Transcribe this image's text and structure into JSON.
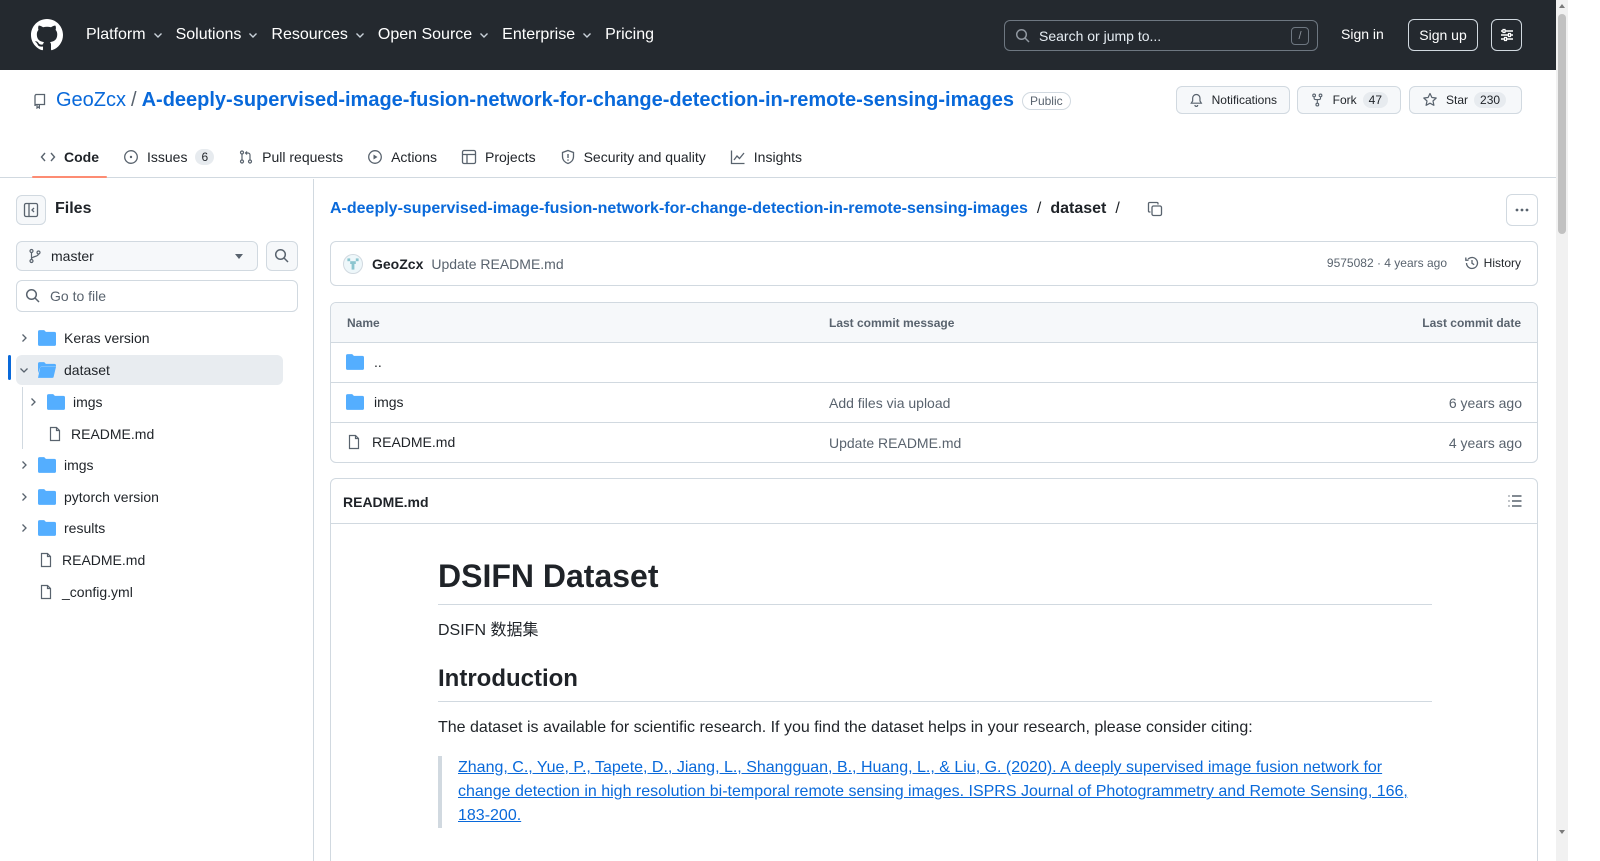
{
  "header": {
    "nav": [
      {
        "label": "Platform",
        "has_menu": true
      },
      {
        "label": "Solutions",
        "has_menu": true
      },
      {
        "label": "Resources",
        "has_menu": true
      },
      {
        "label": "Open Source",
        "has_menu": true
      },
      {
        "label": "Enterprise",
        "has_menu": true
      },
      {
        "label": "Pricing",
        "has_menu": false
      }
    ],
    "search_placeholder": "Search or jump to...",
    "search_shortcut": "/",
    "sign_in": "Sign in",
    "sign_up": "Sign up"
  },
  "repo": {
    "owner": "GeoZcx",
    "separator": "/",
    "name": "A-deeply-supervised-image-fusion-network-for-change-detection-in-remote-sensing-images",
    "visibility": "Public",
    "notifications_label": "Notifications",
    "fork_label": "Fork",
    "fork_count": "47",
    "star_label": "Star",
    "star_count": "230",
    "tabs": [
      {
        "label": "Code",
        "icon": "code-icon",
        "active": true
      },
      {
        "label": "Issues",
        "icon": "issue-icon",
        "count": "6"
      },
      {
        "label": "Pull requests",
        "icon": "pull-request-icon"
      },
      {
        "label": "Actions",
        "icon": "play-icon"
      },
      {
        "label": "Projects",
        "icon": "table-icon"
      },
      {
        "label": "Security and quality",
        "icon": "shield-icon"
      },
      {
        "label": "Insights",
        "icon": "graph-icon"
      }
    ]
  },
  "sidebar": {
    "title": "Files",
    "branch": "master",
    "goto_placeholder": "Go to file",
    "tree": [
      {
        "label": "Keras version",
        "type": "folder",
        "depth": 0,
        "expanded": false
      },
      {
        "label": "dataset",
        "type": "folder",
        "depth": 0,
        "expanded": true,
        "selected": true
      },
      {
        "label": "imgs",
        "type": "folder",
        "depth": 1,
        "expanded": false
      },
      {
        "label": "README.md",
        "type": "file",
        "depth": 1
      },
      {
        "label": "imgs",
        "type": "folder",
        "depth": 0,
        "expanded": false
      },
      {
        "label": "pytorch version",
        "type": "folder",
        "depth": 0,
        "expanded": false
      },
      {
        "label": "results",
        "type": "folder",
        "depth": 0,
        "expanded": false
      },
      {
        "label": "README.md",
        "type": "file",
        "depth": 0
      },
      {
        "label": "_config.yml",
        "type": "file",
        "depth": 0
      }
    ]
  },
  "breadcrumb": {
    "repo_link": "A-deeply-supervised-image-fusion-network-for-change-detection-in-remote-sensing-images",
    "separator": "/",
    "current": "dataset",
    "trailing": "/"
  },
  "commit": {
    "author": "GeoZcx",
    "message": "Update README.md",
    "meta": "9575082 · 4 years ago",
    "history_label": "History"
  },
  "table": {
    "headers": {
      "name": "Name",
      "message": "Last commit message",
      "date": "Last commit date"
    },
    "rows": [
      {
        "name": "..",
        "type": "folder",
        "message": "",
        "date": ""
      },
      {
        "name": "imgs",
        "type": "folder",
        "message": "Add files via upload",
        "date": "6 years ago"
      },
      {
        "name": "README.md",
        "type": "file",
        "message": "Update README.md",
        "date": "4 years ago"
      }
    ]
  },
  "readme": {
    "title": "README.md",
    "h1": "DSIFN Dataset",
    "p1": "DSIFN 数据集",
    "h2": "Introduction",
    "p2": "The dataset is available for scientific research. If you find the dataset helps in your research, please consider citing:",
    "citation": "Zhang, C., Yue, P., Tapete, D., Jiang, L., Shangguan, B., Huang, L., & Liu, G. (2020). A deeply supervised image fusion network for change detection in high resolution bi-temporal remote sensing images. ISPRS Journal of Photogrammetry and Remote Sensing, 166, 183-200."
  },
  "colors": {
    "header_bg": "#24292f",
    "link": "#0969da",
    "folder": "#54aeff",
    "active_tab_underline": "#fd8c73",
    "selected_bar": "#0969da"
  }
}
